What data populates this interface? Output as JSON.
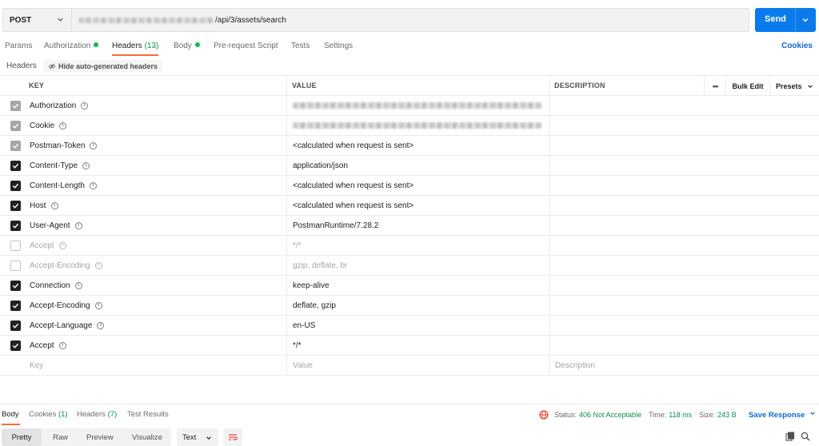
{
  "request": {
    "method": "POST",
    "url_path": "/api/3/assets/search",
    "send_label": "Send"
  },
  "tabs": [
    {
      "label": "Params",
      "count": "",
      "dot": false
    },
    {
      "label": "Authorization",
      "count": "",
      "dot": true
    },
    {
      "label": "Headers",
      "count": "(13)",
      "dot": false
    },
    {
      "label": "Body",
      "count": "",
      "dot": true
    },
    {
      "label": "Pre-request Script",
      "count": "",
      "dot": false
    },
    {
      "label": "Tests",
      "count": "",
      "dot": false
    },
    {
      "label": "Settings",
      "count": "",
      "dot": false
    }
  ],
  "active_tab": "Headers",
  "cookies_link": "Cookies",
  "headers_section": {
    "title": "Headers",
    "hide_auto_label": "Hide auto-generated headers"
  },
  "table": {
    "columns": {
      "key": "KEY",
      "value": "VALUE",
      "description": "DESCRIPTION"
    },
    "more_icon": "ellipsis-icon",
    "bulk_edit": "Bulk Edit",
    "presets": "Presets",
    "rows": [
      {
        "key": "Authorization",
        "value": "",
        "value_redacted": true,
        "state": "auto"
      },
      {
        "key": "Cookie",
        "value": "",
        "value_redacted": true,
        "state": "auto"
      },
      {
        "key": "Postman-Token",
        "value": "<calculated when request is sent>",
        "value_redacted": false,
        "state": "auto"
      },
      {
        "key": "Content-Type",
        "value": "application/json",
        "value_redacted": false,
        "state": "on"
      },
      {
        "key": "Content-Length",
        "value": "<calculated when request is sent>",
        "value_redacted": false,
        "state": "on"
      },
      {
        "key": "Host",
        "value": "<calculated when request is sent>",
        "value_redacted": false,
        "state": "on"
      },
      {
        "key": "User-Agent",
        "value": "PostmanRuntime/7.28.2",
        "value_redacted": false,
        "state": "on"
      },
      {
        "key": "Accept",
        "value": "*/*",
        "value_redacted": false,
        "state": "off"
      },
      {
        "key": "Accept-Encoding",
        "value": "gzip, deflate, br",
        "value_redacted": false,
        "state": "off"
      },
      {
        "key": "Connection",
        "value": "keep-alive",
        "value_redacted": false,
        "state": "on"
      },
      {
        "key": "Accept-Encoding",
        "value": "deflate, gzip",
        "value_redacted": false,
        "state": "on"
      },
      {
        "key": "Accept-Language",
        "value": "en-US",
        "value_redacted": false,
        "state": "on"
      },
      {
        "key": "Accept",
        "value": "*/*",
        "value_redacted": false,
        "state": "on"
      }
    ],
    "new_row": {
      "key_placeholder": "Key",
      "value_placeholder": "Value",
      "description_placeholder": "Description"
    }
  },
  "response": {
    "tabs": [
      {
        "label": "Body",
        "count": ""
      },
      {
        "label": "Cookies",
        "count": "(1)"
      },
      {
        "label": "Headers",
        "count": "(7)"
      },
      {
        "label": "Test Results",
        "count": ""
      }
    ],
    "status_label": "Status:",
    "status_value": "406 Not Acceptable",
    "time_label": "Time:",
    "time_value": "118 ms",
    "size_label": "Size:",
    "size_value": "243 B",
    "save_label": "Save Response",
    "views": [
      "Pretty",
      "Raw",
      "Preview",
      "Visualize"
    ],
    "active_view": "Pretty",
    "format": "Text",
    "colors": {
      "status_ok": "#0a8f4f",
      "accent": "#ff6c37",
      "link": "#0b6ad2",
      "send": "#097bed"
    }
  }
}
